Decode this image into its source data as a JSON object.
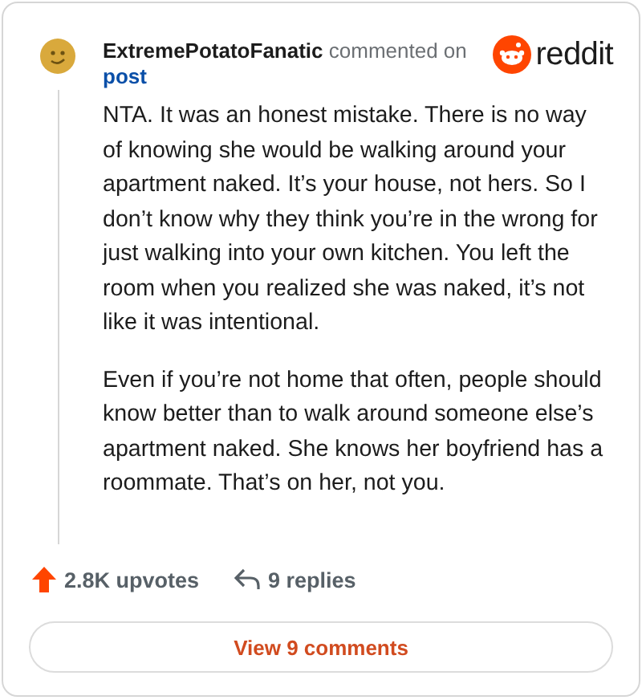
{
  "header": {
    "author": "ExtremePotatoFanatic",
    "action": "commented on",
    "link": "post",
    "brand": "reddit"
  },
  "body": [
    "NTA. It was an honest mistake. There is no way of knowing she would be walking around your apartment naked. It’s your house, not hers. So I don’t know why they think you’re in the wrong for just walking into your own kitchen. You left the room when you realized she was naked, it’s not like it was intentional.",
    "Even if you’re not home that often, people should know better than to walk around someone else’s apartment naked. She knows her boyfriend has a roommate. That’s on her, not you."
  ],
  "footer": {
    "upvotes": "2.8K upvotes",
    "replies": "9 replies"
  },
  "button": "View 9 comments"
}
